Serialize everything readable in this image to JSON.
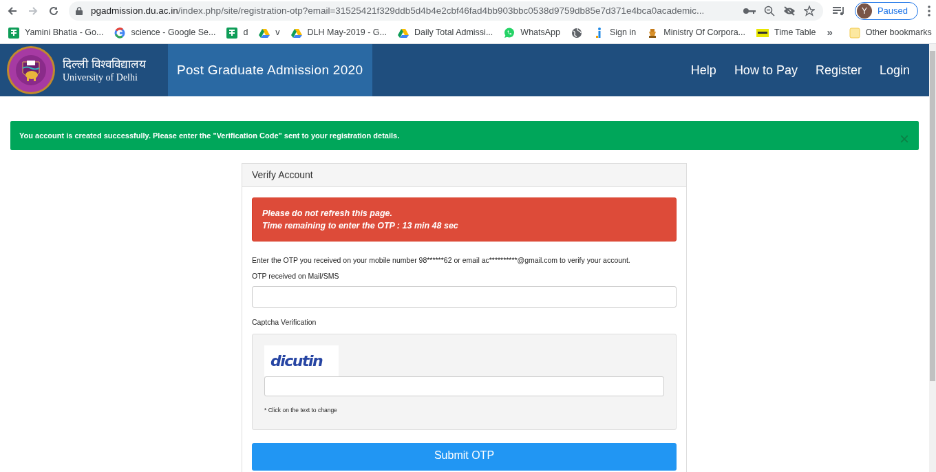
{
  "browser": {
    "url_host": "pgadmission.du.ac.in",
    "url_path": "/index.php/site/registration-otp?email=31525421f329ddb5d4b4e2cbf46fad4bb903bbc0538d9759db85e7d371e4bca0academic...",
    "profile_initial": "Y",
    "profile_status": "Paused",
    "bookmarks": [
      {
        "kind": "sheets",
        "label": "Yamini Bhatia - Go..."
      },
      {
        "kind": "google",
        "label": "science - Google Se..."
      },
      {
        "kind": "sheets",
        "label": "d"
      },
      {
        "kind": "drive",
        "label": "v"
      },
      {
        "kind": "drive",
        "label": "DLH May-2019 - G..."
      },
      {
        "kind": "drive",
        "label": "Daily Total Admissi..."
      },
      {
        "kind": "whatsapp",
        "label": "WhatsApp"
      },
      {
        "kind": "globe"
      },
      {
        "kind": "signin",
        "label": "Sign in"
      },
      {
        "kind": "emblem",
        "label": "Ministry Of Corpora..."
      },
      {
        "kind": "timetable",
        "label": "Time Table"
      }
    ],
    "overflow": "»",
    "other_bookmarks": "Other bookmarks"
  },
  "header": {
    "logo_hindi": "दिल्ली विश्वविद्यालय",
    "logo_english": "University of Delhi",
    "title": "Post Graduate Admission 2020",
    "nav": [
      "Help",
      "How to Pay",
      "Register",
      "Login"
    ]
  },
  "alert": {
    "message": "You account is created successfully. Please enter the \"Verification Code\" sent to your registration details.",
    "close": "×"
  },
  "card": {
    "title": "Verify Account",
    "warning_lines": [
      "Please do not refresh this page.",
      "Time remaining to enter the OTP : 13 min 48 sec"
    ],
    "instructions": "Enter the OTP you received on your mobile number 98******62 or email ac**********@gmail.com to verify your account.",
    "otp_label": "OTP received on Mail/SMS",
    "captcha_label": "Captcha Verification",
    "captcha_text": "dicutin",
    "captcha_hint": "* Click on the text to change",
    "submit": "Submit OTP"
  }
}
